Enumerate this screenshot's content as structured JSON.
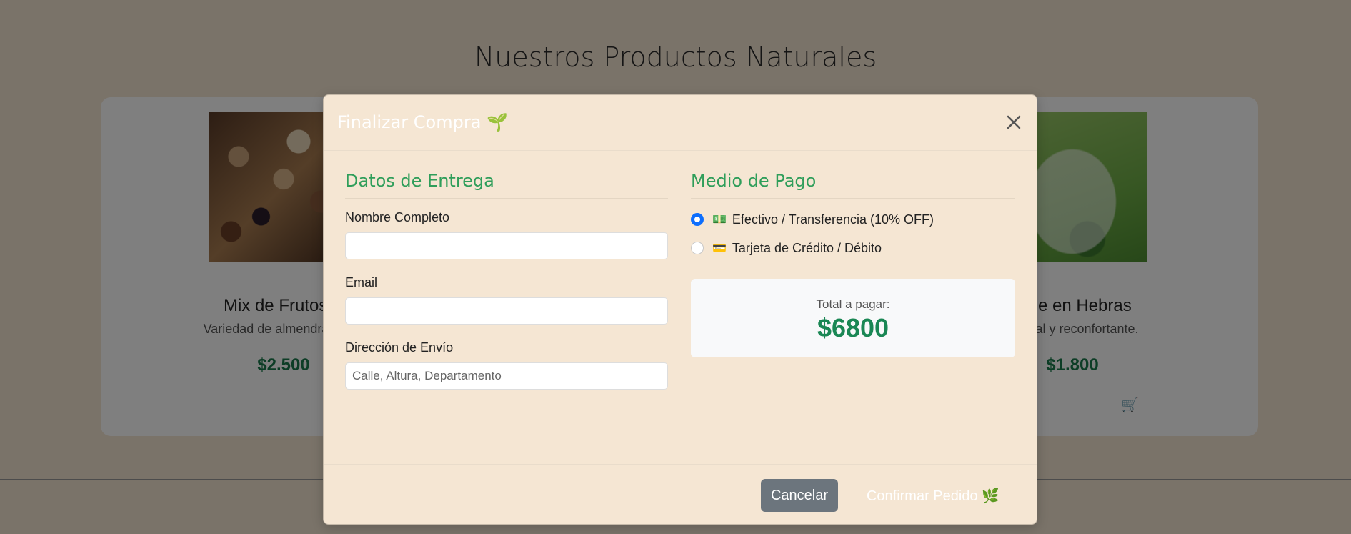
{
  "page": {
    "title": "Nuestros Productos Naturales",
    "products": [
      {
        "name": "Mix de Frutos S",
        "desc": "Variedad de almendras, nue",
        "price": "$2.500"
      },
      {
        "name": "erde en Hebras",
        "desc": "natural y reconfortante.",
        "price": "$1.800"
      }
    ],
    "cart_icon": "🛒"
  },
  "modal": {
    "title": "Finalizar Compra 🌱",
    "delivery": {
      "title": "Datos de Entrega",
      "name_label": "Nombre Completo",
      "name_value": "",
      "email_label": "Email",
      "email_value": "",
      "address_label": "Dirección de Envío",
      "address_placeholder": "Calle, Altura, Departamento"
    },
    "payment": {
      "title": "Medio de Pago",
      "options": [
        {
          "icon": "💵",
          "label": "Efectivo / Transferencia (10% OFF)",
          "checked": true
        },
        {
          "icon": "💳",
          "label": "Tarjeta de Crédito / Débito",
          "checked": false
        }
      ],
      "total_label": "Total a pagar:",
      "total_value": "$6800"
    },
    "footer": {
      "cancel_label": "Cancelar",
      "confirm_label": "Confirmar Pedido 🌿"
    }
  },
  "colors": {
    "accent_green": "#2f9e5a",
    "radio_blue": "#0d6efd",
    "cancel_gray": "#6c757d"
  }
}
